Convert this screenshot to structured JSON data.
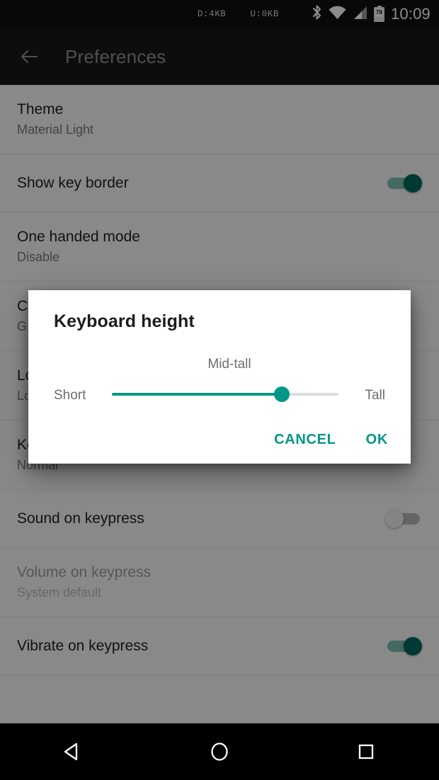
{
  "status_bar": {
    "download": "D:4KB",
    "upload": "U:0KB",
    "bluetooth_icon": "bluetooth-icon",
    "wifi_icon": "wifi-icon",
    "signal_icon": "cell-signal-icon",
    "battery_level": "78",
    "clock": "10:09"
  },
  "toolbar": {
    "back_icon": "back-arrow-icon",
    "title": "Preferences"
  },
  "settings": {
    "rows": [
      {
        "title": "Theme",
        "subtitle": "Material Light",
        "control": "none",
        "state": "",
        "dim": false
      },
      {
        "title": "Show key border",
        "subtitle": "",
        "control": "switch",
        "state": "on",
        "dim": false
      },
      {
        "title": "One handed mode",
        "subtitle": "Disable",
        "control": "none",
        "state": "",
        "dim": false
      },
      {
        "title": "C",
        "subtitle": "G",
        "control": "none",
        "state": "",
        "dim": false
      },
      {
        "title": "Lo",
        "subtitle": "Lo",
        "control": "none",
        "state": "",
        "dim": false
      },
      {
        "title": "Keyboard height",
        "subtitle": "Normal",
        "control": "none",
        "state": "",
        "dim": false
      },
      {
        "title": "Sound on keypress",
        "subtitle": "",
        "control": "switch",
        "state": "off",
        "dim": false
      },
      {
        "title": "Volume on keypress",
        "subtitle": "System default",
        "control": "none",
        "state": "",
        "dim": true
      },
      {
        "title": "Vibrate on keypress",
        "subtitle": "",
        "control": "switch",
        "state": "on",
        "dim": false
      }
    ]
  },
  "dialog": {
    "title": "Keyboard height",
    "slider": {
      "value_label": "Mid-tall",
      "min_label": "Short",
      "max_label": "Tall",
      "percent": 75
    },
    "cancel_label": "CANCEL",
    "ok_label": "OK",
    "accent_color": "#009688"
  },
  "nav_bar": {
    "back_icon": "nav-back-triangle-icon",
    "home_icon": "nav-home-circle-icon",
    "recents_icon": "nav-recents-square-icon"
  }
}
